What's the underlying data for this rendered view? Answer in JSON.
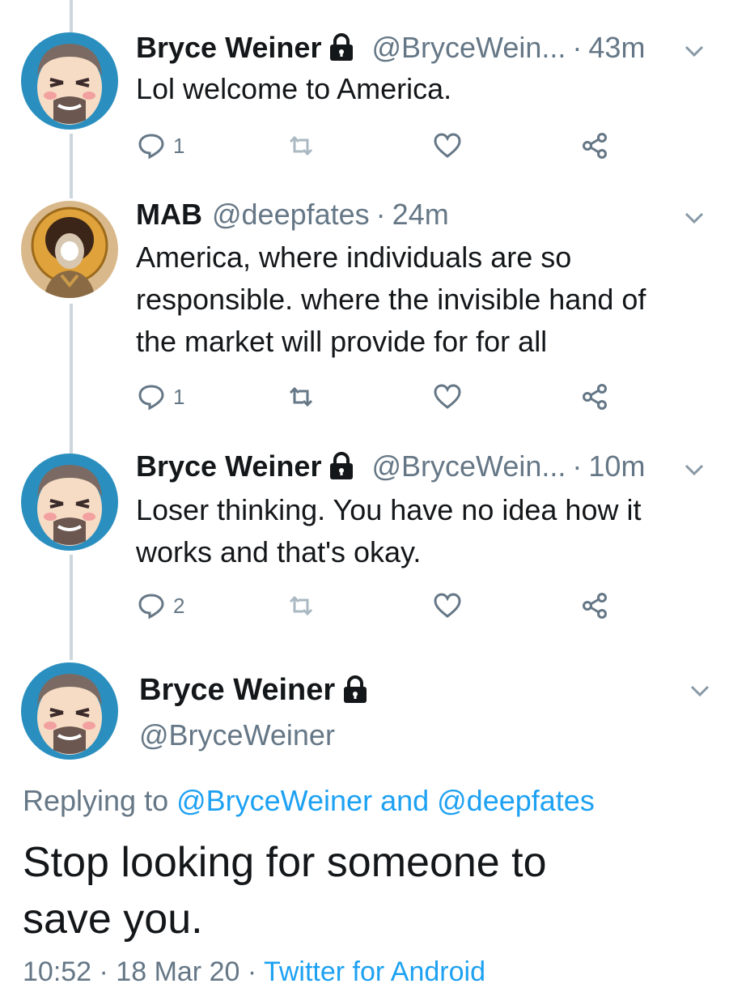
{
  "colors": {
    "text": "#14171a",
    "muted": "#657786",
    "accent": "#1da1f2",
    "thread": "#ccd6dd"
  },
  "tweets": [
    {
      "name": "Bryce Weiner",
      "protected": true,
      "handle": "@BryceWein...",
      "sep": "·",
      "time": "43m",
      "text": "Lol welcome to America.",
      "reply_count": "1",
      "avatar": "bryce-avatar"
    },
    {
      "name": "MAB",
      "protected": false,
      "handle": "@deepfates",
      "sep": "·",
      "time": "24m",
      "text_lines": [
        "America, where individuals are so",
        "responsible. where the invisible hand of",
        "the market will provide for for all"
      ],
      "reply_count": "1",
      "avatar": "mab-avatar"
    },
    {
      "name": "Bryce Weiner",
      "protected": true,
      "handle": "@BryceWein...",
      "sep": "·",
      "time": "10m",
      "text_lines": [
        "Loser thinking. You have no idea how it",
        "works and that's okay."
      ],
      "reply_count": "2",
      "avatar": "bryce-avatar"
    }
  ],
  "main_tweet": {
    "name": "Bryce Weiner",
    "handle": "@BryceWeiner",
    "replying_prefix": "Replying to ",
    "replying_user1": "@BryceWeiner",
    "replying_and": " and ",
    "replying_user2": "@deepfates",
    "text_lines": [
      "Stop looking for someone to",
      "save you."
    ],
    "meta_time": "10:52 · 18 Mar 20 · ",
    "meta_source": "Twitter for Android"
  },
  "icons": [
    "reply-icon",
    "retweet-icon",
    "like-icon",
    "share-icon",
    "lock-icon",
    "chevron-down-icon"
  ]
}
